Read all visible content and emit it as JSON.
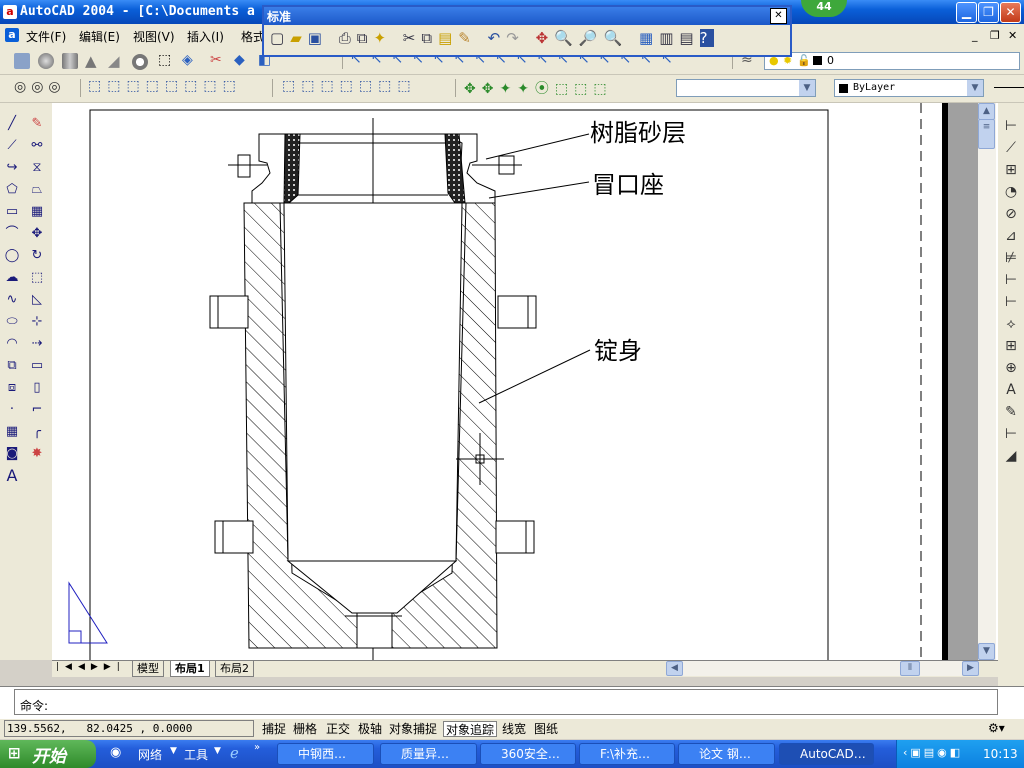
{
  "window": {
    "title": "AutoCAD 2004 - [C:\\Documents a",
    "app_icon": "a"
  },
  "menus": [
    "文件(F)",
    "编辑(E)",
    "视图(V)",
    "插入(I)",
    "格式"
  ],
  "std_toolbar": {
    "title": "标准"
  },
  "layer_combo": {
    "value": "0"
  },
  "color_combo": {
    "value": "ByLayer"
  },
  "drawing": {
    "labels": [
      "树脂砂层",
      "冒口座",
      "锭身"
    ]
  },
  "layout_tabs": [
    "模型",
    "布局1",
    "布局2"
  ],
  "active_tab": "布局1",
  "command": {
    "prompt": "命令:"
  },
  "status": {
    "coords": "139.5562,   82.0425 , 0.0000",
    "toggles": [
      {
        "label": "捕捉",
        "on": false
      },
      {
        "label": "栅格",
        "on": false
      },
      {
        "label": "正交",
        "on": false
      },
      {
        "label": "极轴",
        "on": false
      },
      {
        "label": "对象捕捉",
        "on": false
      },
      {
        "label": "对象追踪",
        "on": true
      },
      {
        "label": "线宽",
        "on": false
      },
      {
        "label": "图纸",
        "on": false
      }
    ]
  },
  "taskbar": {
    "start": "开始",
    "quick": [
      "网络",
      "工具"
    ],
    "items": [
      "中钢西…",
      "质量异…",
      "360安全…",
      "F:\\补充…",
      "论文 钢…",
      "AutoCAD…"
    ],
    "active": "AutoCAD…",
    "clock": "10:13"
  },
  "badge": "44",
  "colors": {
    "titlebar": "#0a5fd8",
    "taskbar": "#245edb",
    "start": "#3c9a36",
    "canvas": "#ffffff"
  }
}
